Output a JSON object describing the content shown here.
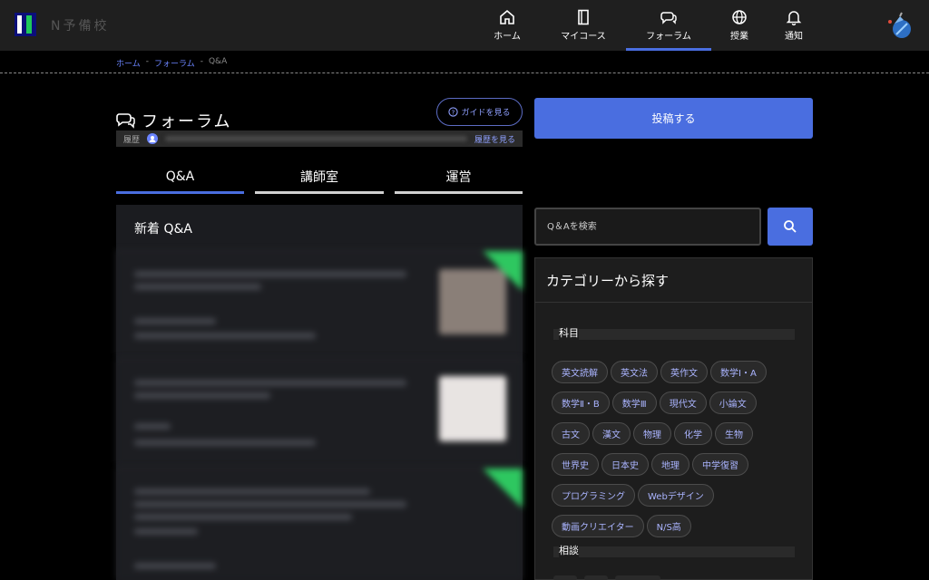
{
  "header": {
    "logo_text": "N予備校",
    "nav": [
      {
        "label": "ホーム",
        "icon": "home-icon"
      },
      {
        "label": "マイコース",
        "icon": "book-icon"
      },
      {
        "label": "フォーラム",
        "icon": "chat-bubbles-icon"
      },
      {
        "label": "授業",
        "icon": "globe-icon"
      },
      {
        "label": "通知",
        "icon": "bell-icon"
      }
    ],
    "active_nav": "フォーラム"
  },
  "breadcrumb": {
    "home": "ホーム",
    "forum": "フォーラム",
    "current": "Q&A",
    "separator": "-"
  },
  "forum": {
    "title": "フォーラム",
    "guide_button": "ガイドを見る",
    "history_label": "履歴",
    "history_link": "履歴を見る"
  },
  "tabs": [
    {
      "label": "Q&A"
    },
    {
      "label": "講師室"
    },
    {
      "label": "運営"
    }
  ],
  "active_tab": "Q&A",
  "feed": {
    "title": "新着 Q&A"
  },
  "sidebar": {
    "post_button": "投稿する",
    "search_placeholder": "Q＆Aを検索",
    "category_heading": "カテゴリーから探す",
    "subjects_title": "科目",
    "subjects": [
      "英文読解",
      "英文法",
      "英作文",
      "数学Ⅰ・A",
      "数学Ⅱ・B",
      "数学Ⅲ",
      "現代文",
      "小論文",
      "古文",
      "漢文",
      "物理",
      "化学",
      "生物",
      "世界史",
      "日本史",
      "地理",
      "中学復習",
      "プログラミング",
      "Webデザイン",
      "動画クリエイター",
      "N/S高"
    ],
    "consult_title": "相談"
  },
  "colors": {
    "accent": "#4a6ee0",
    "link": "#6b84ff",
    "new_badge": "#2ec760",
    "header_bg": "#1f1f1f"
  }
}
